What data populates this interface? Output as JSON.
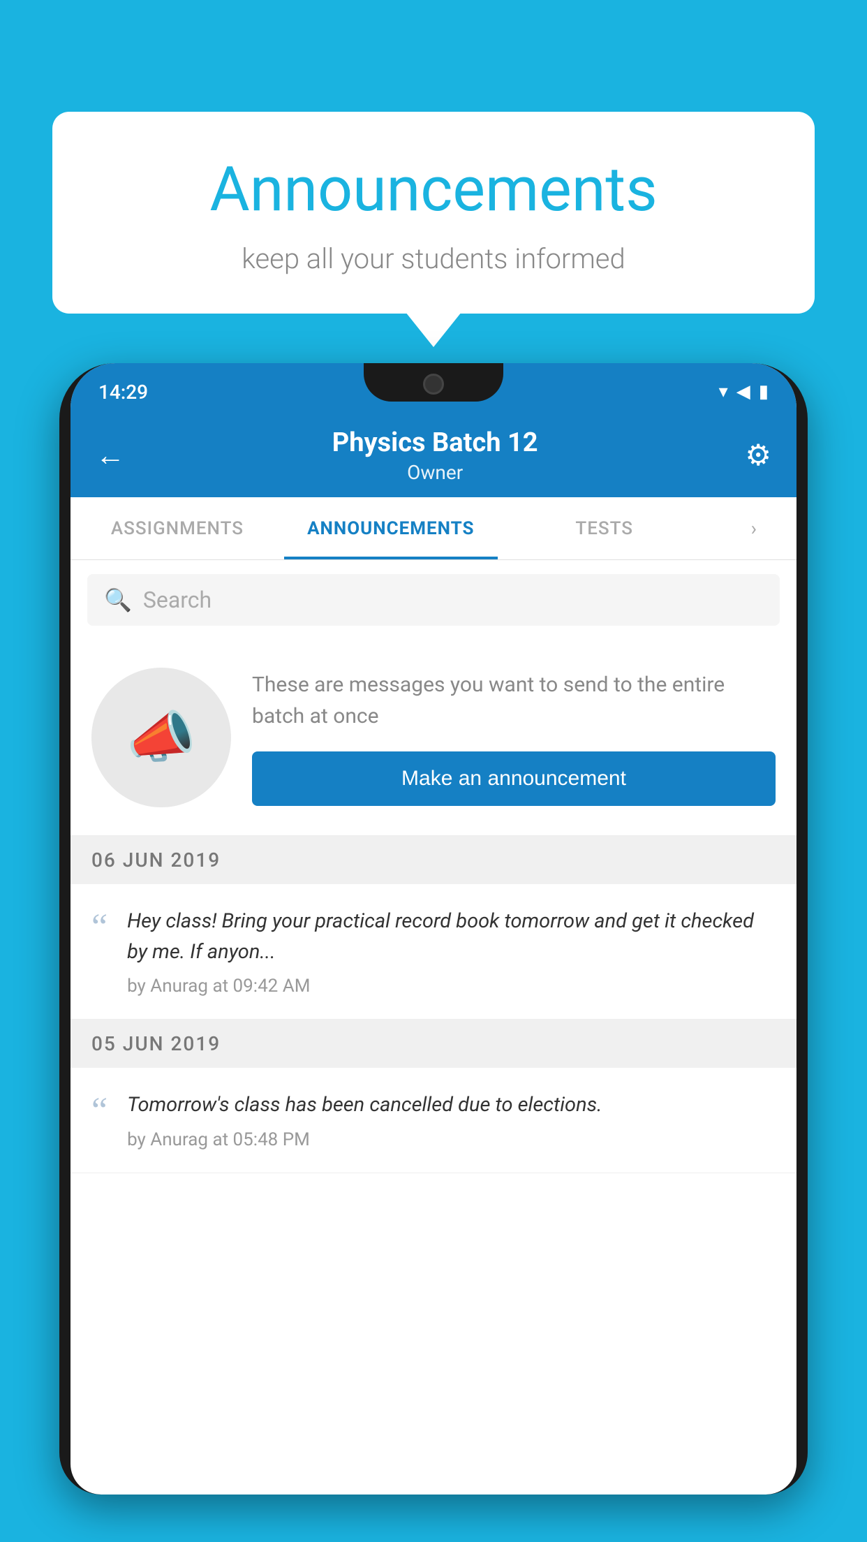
{
  "page": {
    "background_color": "#1ab3e0"
  },
  "speech_bubble": {
    "title": "Announcements",
    "subtitle": "keep all your students informed"
  },
  "status_bar": {
    "time": "14:29",
    "wifi": "▾",
    "signal": "▲",
    "battery": "▮"
  },
  "header": {
    "title": "Physics Batch 12",
    "subtitle": "Owner",
    "back_label": "←",
    "gear_label": "⚙"
  },
  "tabs": [
    {
      "label": "ASSIGNMENTS",
      "active": false
    },
    {
      "label": "ANNOUNCEMENTS",
      "active": true
    },
    {
      "label": "TESTS",
      "active": false
    }
  ],
  "search": {
    "placeholder": "Search"
  },
  "promo": {
    "description": "These are messages you want to send to the entire batch at once",
    "button_label": "Make an announcement"
  },
  "announcements": [
    {
      "date": "06  JUN  2019",
      "text": "Hey class! Bring your practical record book tomorrow and get it checked by me. If anyon...",
      "meta": "by Anurag at 09:42 AM"
    },
    {
      "date": "05  JUN  2019",
      "text": "Tomorrow's class has been cancelled due to elections.",
      "meta": "by Anurag at 05:48 PM"
    }
  ]
}
